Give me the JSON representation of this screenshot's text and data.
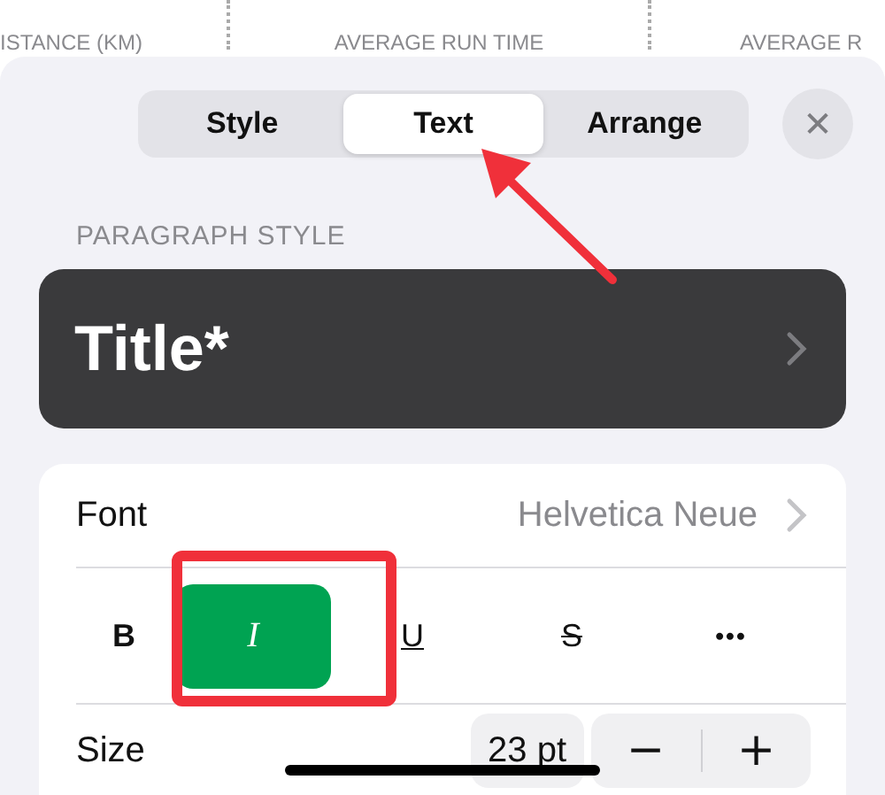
{
  "table_header": {
    "columns": [
      "ISTANCE (KM)",
      "AVERAGE RUN TIME",
      "AVERAGE R"
    ]
  },
  "tabs": [
    {
      "label": "Style",
      "selected": false
    },
    {
      "label": "Text",
      "selected": true
    },
    {
      "label": "Arrange",
      "selected": false
    }
  ],
  "close_button": "✕",
  "paragraph_style": {
    "heading": "PARAGRAPH STYLE",
    "value": "Title*"
  },
  "font": {
    "label": "Font",
    "value": "Helvetica Neue"
  },
  "text_styles": [
    {
      "label": "B",
      "kind": "bold",
      "selected": false
    },
    {
      "label": "I",
      "kind": "italic",
      "selected": true
    },
    {
      "label": "U",
      "kind": "underline",
      "selected": false
    },
    {
      "label": "S",
      "kind": "strikethrough",
      "selected": false
    },
    {
      "label": "•••",
      "kind": "more",
      "selected": false
    }
  ],
  "size": {
    "label": "Size",
    "value": "23 pt",
    "decrease": "−",
    "increase": "+"
  }
}
